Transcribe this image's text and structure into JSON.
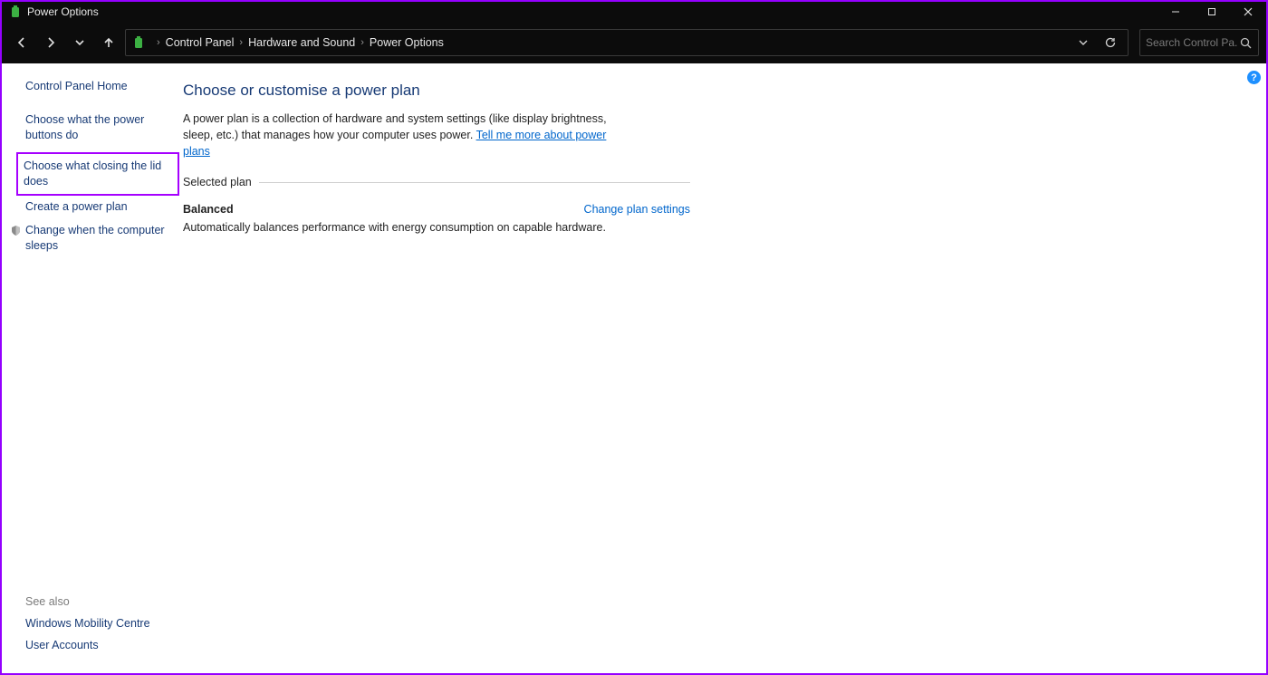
{
  "titlebar": {
    "title": "Power Options"
  },
  "breadcrumb": {
    "items": [
      "Control Panel",
      "Hardware and Sound",
      "Power Options"
    ]
  },
  "search": {
    "placeholder": "Search Control Pa..."
  },
  "sidebar": {
    "home": "Control Panel Home",
    "links": [
      "Choose what the power buttons do",
      "Choose what closing the lid does",
      "Create a power plan",
      "Change when the computer sleeps"
    ],
    "see_also_header": "See also",
    "see_also": [
      "Windows Mobility Centre",
      "User Accounts"
    ]
  },
  "main": {
    "title": "Choose or customise a power plan",
    "description": "A power plan is a collection of hardware and system settings (like display brightness, sleep, etc.) that manages how your computer uses power. ",
    "more_link": "Tell me more about power plans",
    "section_label": "Selected plan",
    "plan_name": "Balanced",
    "change_link": "Change plan settings",
    "plan_description": "Automatically balances performance with energy consumption on capable hardware."
  },
  "help": "?"
}
